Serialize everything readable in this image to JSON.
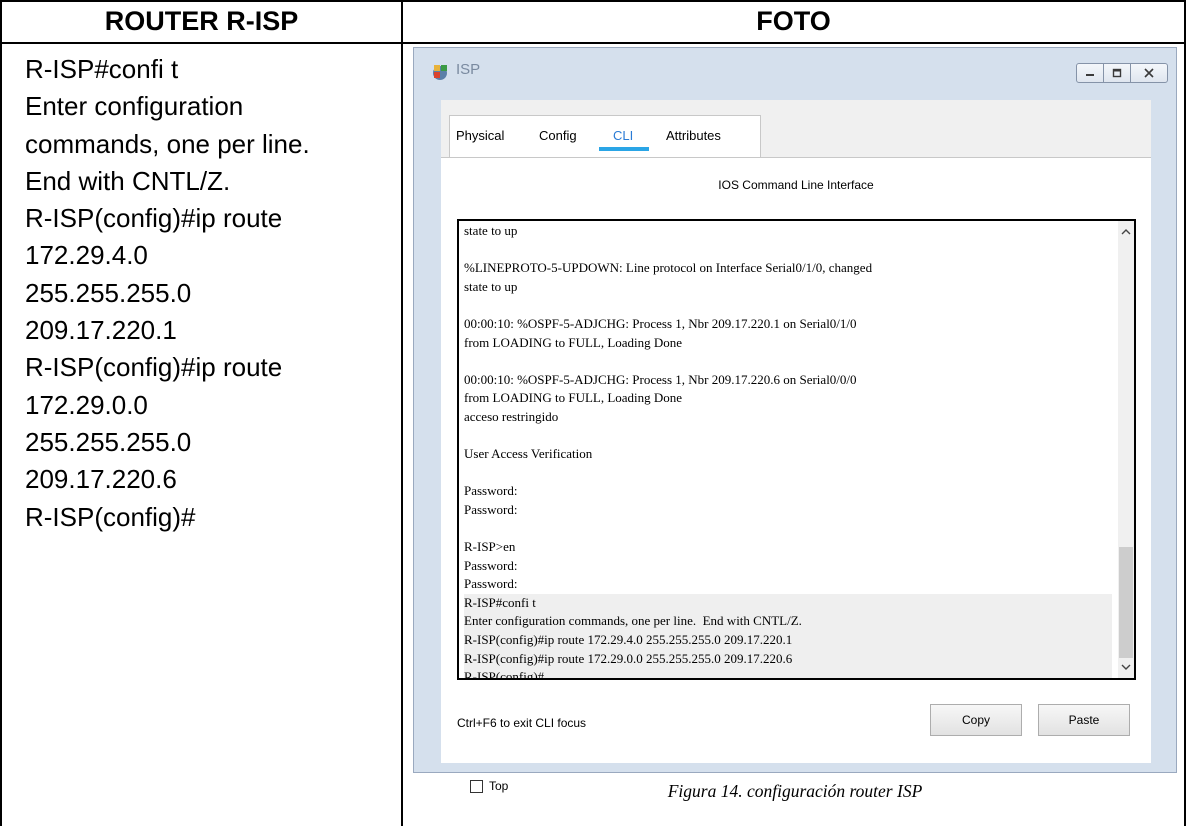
{
  "table": {
    "header_left": "ROUTER R-ISP",
    "header_right": "FOTO",
    "left_lines": [
      "R-ISP#confi t",
      "Enter configuration",
      "commands, one per line.",
      "End with CNTL/Z.",
      "R-ISP(config)#ip route",
      "172.29.4.0",
      "255.255.255.0",
      "209.17.220.1",
      "R-ISP(config)#ip route",
      "172.29.0.0",
      "255.255.255.0",
      "209.17.220.6",
      "R-ISP(config)#"
    ]
  },
  "window": {
    "title": "ISP",
    "tabs": [
      "Physical",
      "Config",
      "CLI",
      "Attributes"
    ],
    "active_tab": "CLI",
    "panel_heading": "IOS Command Line Interface",
    "terminal_lines": [
      "state to up",
      "",
      "%LINEPROTO-5-UPDOWN: Line protocol on Interface Serial0/1/0, changed",
      "state to up",
      "",
      "00:00:10: %OSPF-5-ADJCHG: Process 1, Nbr 209.17.220.1 on Serial0/1/0",
      "from LOADING to FULL, Loading Done",
      "",
      "00:00:10: %OSPF-5-ADJCHG: Process 1, Nbr 209.17.220.6 on Serial0/0/0",
      "from LOADING to FULL, Loading Done",
      "acceso restringido",
      "",
      "User Access Verification",
      "",
      "Password:",
      "Password:",
      "",
      "R-ISP>en",
      "Password:",
      "Password:",
      "R-ISP#confi t",
      "Enter configuration commands, one per line.  End with CNTL/Z.",
      "R-ISP(config)#ip route 172.29.4.0 255.255.255.0 209.17.220.1",
      "R-ISP(config)#ip route 172.29.0.0 255.255.255.0 209.17.220.6",
      "R-ISP(config)#"
    ],
    "highlight_from_line": 20,
    "hint": "Ctrl+F6 to exit CLI focus",
    "copy_label": "Copy",
    "paste_label": "Paste",
    "top_checkbox_label": "Top",
    "top_checked": false
  },
  "caption": "Figura 14. configuración router ISP"
}
